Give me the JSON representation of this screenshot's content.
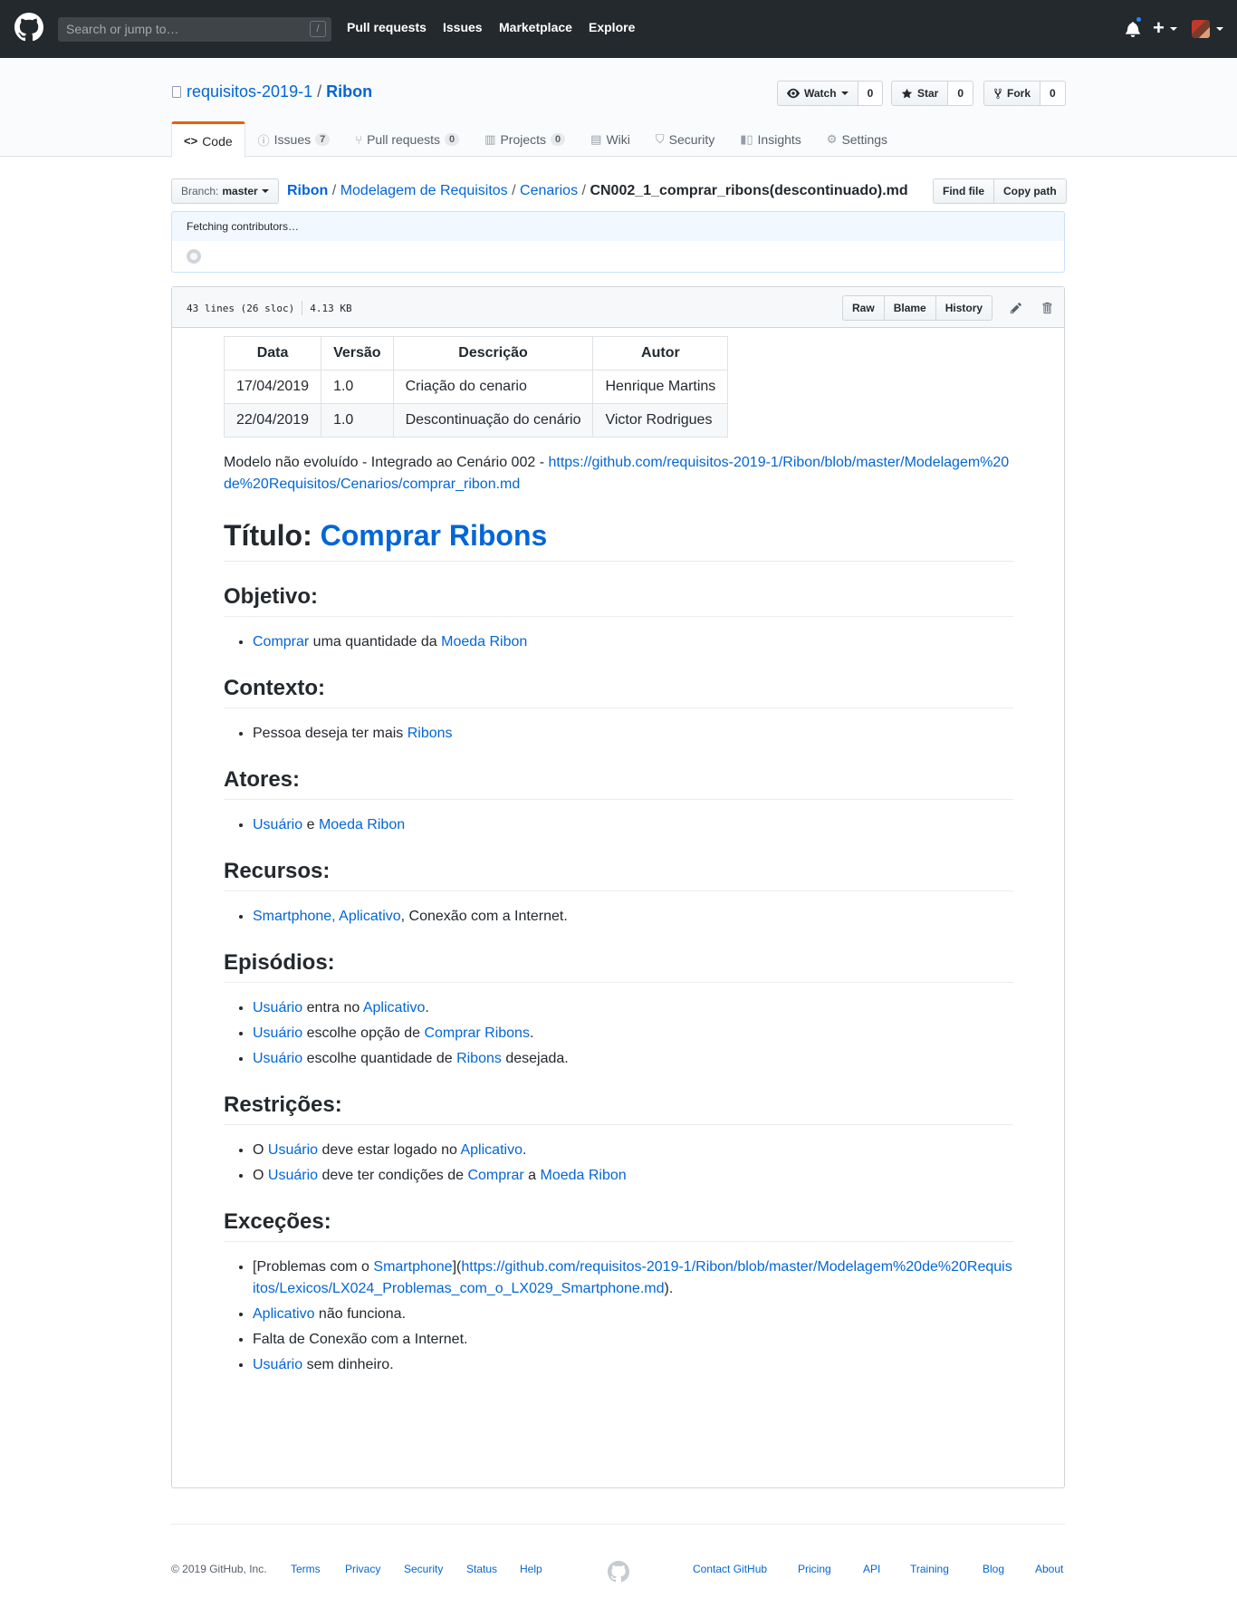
{
  "header": {
    "search_placeholder": "Search or jump to…",
    "search_key": "/",
    "nav": [
      "Pull requests",
      "Issues",
      "Marketplace",
      "Explore"
    ],
    "plus": "+"
  },
  "repo": {
    "owner": "requisitos-2019-1",
    "separator": "/",
    "name": "Ribon",
    "watch": {
      "label": "Watch",
      "count": "0"
    },
    "star": {
      "label": "Star",
      "count": "0"
    },
    "fork": {
      "label": "Fork",
      "count": "0"
    },
    "tabs": [
      {
        "label": "Code",
        "icon": "code-icon"
      },
      {
        "label": "Issues",
        "counter": "7",
        "icon": "issue-icon"
      },
      {
        "label": "Pull requests",
        "counter": "0",
        "icon": "pull-request-icon"
      },
      {
        "label": "Projects",
        "counter": "0",
        "icon": "project-icon"
      },
      {
        "label": "Wiki",
        "icon": "book-icon"
      },
      {
        "label": "Security",
        "icon": "shield-icon"
      },
      {
        "label": "Insights",
        "icon": "graph-icon"
      },
      {
        "label": "Settings",
        "icon": "gear-icon"
      }
    ]
  },
  "breadcrumb": {
    "branch_label": "Branch:",
    "branch": "master",
    "root": "Ribon",
    "dir1": "Modelagem de Requisitos",
    "dir2": "Cenarios",
    "file": "CN002_1_comprar_ribons(descontinuado).md",
    "sep": "/",
    "find_file": "Find file",
    "copy_path": "Copy path"
  },
  "commit": {
    "fetching": "Fetching contributors…"
  },
  "file": {
    "lines": "43 lines (26 sloc)",
    "size": "4.13 KB",
    "raw": "Raw",
    "blame": "Blame",
    "history": "History"
  },
  "doc": {
    "table": {
      "headers": [
        "Data",
        "Versão",
        "Descrição",
        "Autor"
      ],
      "rows": [
        [
          "17/04/2019",
          "1.0",
          "Criação do cenario",
          "Henrique Martins"
        ],
        [
          "22/04/2019",
          "1.0",
          "Descontinuação do cenário",
          "Victor Rodrigues"
        ]
      ]
    },
    "intro_text": "Modelo não evoluído - Integrado ao Cenário 002 - ",
    "intro_link": "https://github.com/requisitos-2019-1/Ribon/blob/master/Modelagem%20de%20Requisitos/Cenarios/comprar_ribon.md",
    "title_label": "Título: ",
    "title_link": "Comprar Ribons",
    "objetivo": {
      "heading": "Objetivo:",
      "l1": "Comprar",
      "t1": " uma quantidade da ",
      "l2": "Moeda Ribon"
    },
    "contexto": {
      "heading": "Contexto:",
      "t1": "Pessoa deseja ter mais ",
      "l1": "Ribons"
    },
    "atores": {
      "heading": "Atores:",
      "l1": "Usuário",
      "t1": " e ",
      "l2": "Moeda Ribon"
    },
    "recursos": {
      "heading": "Recursos:",
      "l1": "Smartphone, Aplicativo",
      "t1": ", Conexão com a Internet."
    },
    "episodios": {
      "heading": "Episódios:",
      "e1": {
        "l1": "Usuário",
        "t1": " entra no ",
        "l2": "Aplicativo",
        "t2": "."
      },
      "e2": {
        "l1": "Usuário",
        "t1": " escolhe opção de ",
        "l2": "Comprar Ribons",
        "t2": "."
      },
      "e3": {
        "l1": "Usuário",
        "t1": " escolhe quantidade de ",
        "l2": "Ribons",
        "t2": " desejada."
      }
    },
    "restricoes": {
      "heading": "Restrições:",
      "r1": {
        "t0": "O ",
        "l1": "Usuário",
        "t1": " deve estar logado no ",
        "l2": "Aplicativo",
        "t2": "."
      },
      "r2": {
        "t0": "O ",
        "l1": "Usuário",
        "t1": " deve ter condições de ",
        "l2": "Comprar",
        "t2": " a ",
        "l3": "Moeda Ribon"
      }
    },
    "excecoes": {
      "heading": "Exceções:",
      "x1": {
        "t0": "[Problemas com o ",
        "l1": "Smartphone",
        "t1": "](",
        "l2": "https://github.com/requisitos-2019-1/Ribon/blob/master/Modelagem%20de%20Requisitos/Lexicos/LX024_Problemas_com_o_LX029_Smartphone.md",
        "t2": ")."
      },
      "x2": {
        "l1": "Aplicativo",
        "t1": " não funciona."
      },
      "x3": {
        "t0": "Falta de Conexão com a Internet."
      },
      "x4": {
        "l1": "Usuário",
        "t1": " sem dinheiro."
      }
    }
  },
  "footer": {
    "copyright": "© 2019 GitHub, Inc.",
    "left_links": [
      "Terms",
      "Privacy",
      "Security",
      "Status",
      "Help"
    ],
    "right_links": [
      "Contact GitHub",
      "Pricing",
      "API",
      "Training",
      "Blog",
      "About"
    ]
  },
  "colors": {
    "header_bg": "#24292e",
    "link": "#0366d6",
    "tab_accent": "#e36209",
    "notification": "#2188ff"
  }
}
